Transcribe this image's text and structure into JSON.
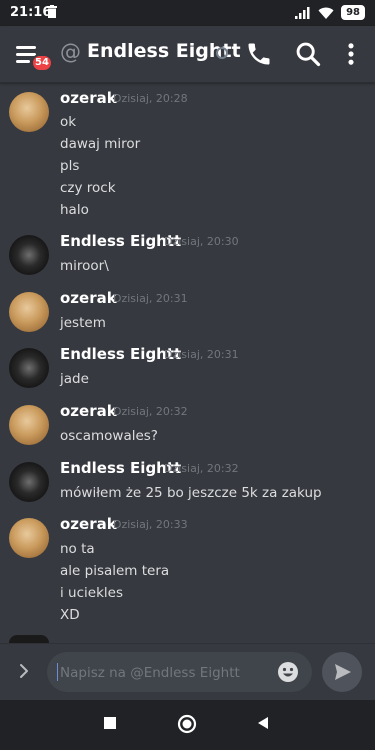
{
  "status_bar": {
    "time": "21:16",
    "battery": "98"
  },
  "header": {
    "badge_count": "54",
    "at_symbol": "@",
    "title": "Endless Eightt"
  },
  "messages": [
    {
      "author": "ozerak",
      "timestamp": "Dzisiaj, 20:28",
      "lines": [
        "ok",
        "dawaj miror",
        "pls",
        "czy rock",
        "halo"
      ]
    },
    {
      "author": "Endless Eightt",
      "timestamp": "Dzisiaj, 20:30",
      "lines": [
        "miroor\\"
      ]
    },
    {
      "author": "ozerak",
      "timestamp": "Dzisiaj, 20:31",
      "lines": [
        "jestem"
      ]
    },
    {
      "author": "Endless Eightt",
      "timestamp": "Dzisiaj, 20:31",
      "lines": [
        "jade"
      ]
    },
    {
      "author": "ozerak",
      "timestamp": "Dzisiaj, 20:32",
      "lines": [
        "oscamowales?"
      ]
    },
    {
      "author": "Endless Eightt",
      "timestamp": "Dzisiaj, 20:32",
      "lines": [
        "mówiłem że 25 bo jeszcze 5k za zakup"
      ]
    },
    {
      "author": "ozerak",
      "timestamp": "Dzisiaj, 20:33",
      "lines": [
        "no ta",
        "ale pisalem tera",
        "i uciekles",
        "XD"
      ]
    }
  ],
  "composer": {
    "placeholder": "Napisz na @Endless Eightt",
    "value": ""
  },
  "icons": {
    "menu": "hamburger-menu-icon",
    "call": "phone-icon",
    "search": "search-icon",
    "more": "more-vertical-icon",
    "expand": "chevron-right-icon",
    "emoji": "emoji-icon",
    "send": "send-icon"
  },
  "colors": {
    "background": "#36393f",
    "badge": "#ed4245",
    "timestamp": "#72767d",
    "text": "#dcddde",
    "author": "#ffffff"
  }
}
